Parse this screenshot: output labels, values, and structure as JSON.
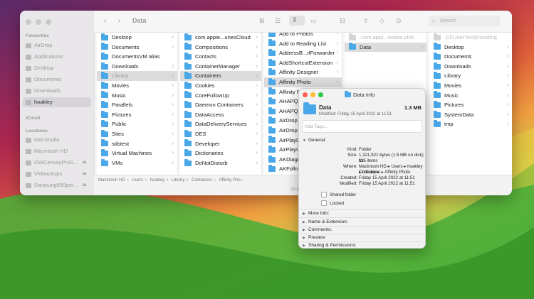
{
  "window": {
    "title": "Data",
    "search_placeholder": "Search"
  },
  "sidebar": {
    "favourites_header": "Favourites",
    "favourites": [
      "AirDrop",
      "Applications",
      "Desktop",
      "Documents",
      "Downloads",
      "hoakley"
    ],
    "selected": "hoakley",
    "icloud_header": "iCloud",
    "locations_header": "Locations",
    "locations": [
      "MacStudio",
      "Macintosh HD",
      "OWCenvoyProS...",
      "VMbackups",
      "Samsung990pro..."
    ]
  },
  "columns": [
    {
      "rows": [
        {
          "label": "Desktop"
        },
        {
          "label": "Documents"
        },
        {
          "label": "DocumentsVM alias"
        },
        {
          "label": "Downloads"
        },
        {
          "label": "Library",
          "sel": true
        },
        {
          "label": "Movies"
        },
        {
          "label": "Music"
        },
        {
          "label": "Parallels"
        },
        {
          "label": "Pictures"
        },
        {
          "label": "Public"
        },
        {
          "label": "Sites"
        },
        {
          "label": "stibtest"
        },
        {
          "label": "Virtual Machines"
        },
        {
          "label": "VMs"
        }
      ]
    },
    {
      "rows": [
        {
          "label": "com.apple...unesCloud"
        },
        {
          "label": "Compositions"
        },
        {
          "label": "Contacts"
        },
        {
          "label": "ContainerManager"
        },
        {
          "label": "Containers",
          "sel": true
        },
        {
          "label": "Cookies"
        },
        {
          "label": "CoreFollowUp"
        },
        {
          "label": "Daemon Containers"
        },
        {
          "label": "DataAccess"
        },
        {
          "label": "DataDeliveryServices"
        },
        {
          "label": "DES"
        },
        {
          "label": "Developer"
        },
        {
          "label": "Dictionaries"
        },
        {
          "label": "DoNotDisturb"
        }
      ]
    },
    {
      "rows": [
        {
          "label": "Add to Photos"
        },
        {
          "label": "Add to Reading List"
        },
        {
          "label": "AddressB...rlForwarder"
        },
        {
          "label": "AddShortcutExtension"
        },
        {
          "label": "Affinity Designer"
        },
        {
          "label": "Affinity Photo",
          "sel": true
        },
        {
          "label": "Affinity Publisher"
        },
        {
          "label": "AHAPQuickLook"
        },
        {
          "label": "AHAPQuickLook"
        },
        {
          "label": "AirDrop"
        },
        {
          "label": "AirDrop"
        },
        {
          "label": "AirPlayDemo"
        },
        {
          "label": "AirPlayUI"
        },
        {
          "label": "AKDiagnostics"
        },
        {
          "label": "AKFollowUp"
        }
      ]
    },
    {
      "rows": [
        {
          "label": ".com.appl...tadata.plist",
          "dim": true
        },
        {
          "label": "Data",
          "sel": true
        }
      ]
    },
    {
      "rows": [
        {
          "label": ".CFUserTextEncoding",
          "dim": true
        },
        {
          "label": "Desktop"
        },
        {
          "label": "Documents"
        },
        {
          "label": "Downloads"
        },
        {
          "label": "Library"
        },
        {
          "label": "Movies"
        },
        {
          "label": "Music"
        },
        {
          "label": "Pictures"
        },
        {
          "label": "SystemData"
        },
        {
          "label": "tmp"
        }
      ]
    }
  ],
  "pathbar": [
    "Macintosh HD",
    "Users",
    "hoakley",
    "Library",
    "Containers",
    "Affinity Pho..."
  ],
  "status": "10 items, 1...",
  "info": {
    "window_title": "Data Info",
    "name": "Data",
    "size": "1.3 MB",
    "modified": "Modified: Friday 15 April 2022 at 11:51",
    "tags_placeholder": "Add Tags...",
    "general_label": "General:",
    "kind_k": "Kind:",
    "kind_v": "Folder",
    "size_k": "Size:",
    "size_v": "1,321,521 bytes (1.5 MB on disk) for",
    "size_v2": "115 items",
    "where_k": "Where:",
    "where_v": "Macintosh HD ▸ Users ▸ hoakley ▸ Library ▸",
    "where_v2": "Containers ▸ Affinity Photo",
    "created_k": "Created:",
    "created_v": "Friday 15 April 2022 at 11:51",
    "modified_k": "Modified:",
    "modified_v": "Friday 15 April 2022 at 11:51",
    "shared_label": "Shared folder",
    "locked_label": "Locked",
    "more_info": "More Info:",
    "name_ext": "Name & Extension:",
    "comments": "Comments:",
    "preview": "Preview:",
    "sharing": "Sharing & Permissions:"
  }
}
